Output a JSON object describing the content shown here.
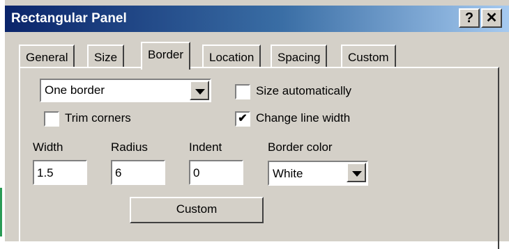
{
  "window": {
    "title": "Rectangular Panel",
    "help_label": "?",
    "close_label": "✕"
  },
  "tabs": [
    {
      "label": "General"
    },
    {
      "label": "Size"
    },
    {
      "label": "Border"
    },
    {
      "label": "Location"
    },
    {
      "label": "Spacing"
    },
    {
      "label": "Custom"
    }
  ],
  "border": {
    "style_value": "One border",
    "size_auto_label": "Size automatically",
    "trim_corners_label": "Trim corners",
    "change_line_width_label": "Change line width",
    "change_line_width_checked": true,
    "width_label": "Width",
    "width_value": "1.5",
    "radius_label": "Radius",
    "radius_value": "6",
    "indent_label": "Indent",
    "indent_value": "0",
    "border_color_label": "Border color",
    "border_color_value": "White",
    "custom_button": "Custom",
    "checkmark": "✔"
  }
}
